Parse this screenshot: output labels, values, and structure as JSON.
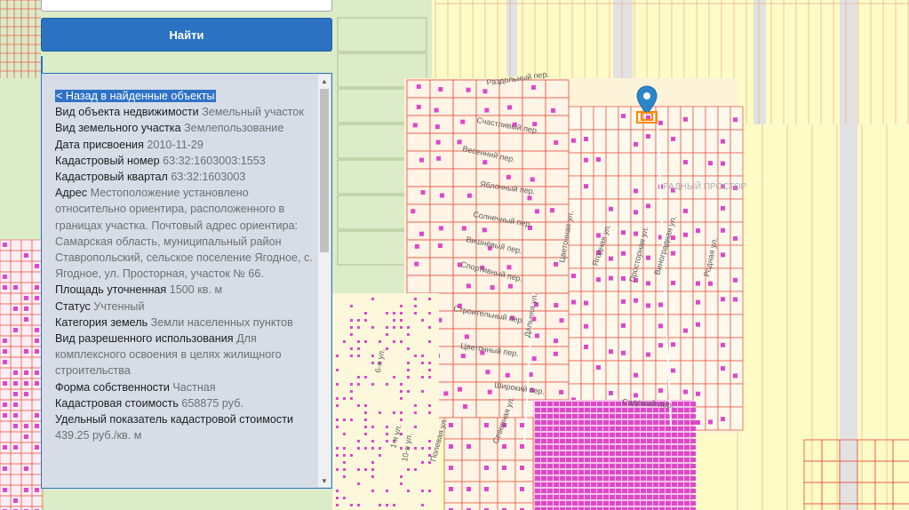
{
  "search": {
    "button_label": "Найти"
  },
  "info": {
    "back_link": "< Назад в найденные объекты",
    "fields": [
      {
        "label": "Вид объекта недвижимости",
        "value": "Земельный участок"
      },
      {
        "label": "Вид земельного участка",
        "value": "Землепользование"
      },
      {
        "label": "Дата присвоения",
        "value": "2010-11-29"
      },
      {
        "label": "Кадастровый номер",
        "value": "63:32:1603003:1553"
      },
      {
        "label": "Кадастровый квартал",
        "value": "63:32:1603003"
      },
      {
        "label": "Адрес",
        "value": "Местоположение установлено относительно ориентира, расположенного в границах участка. Почтовый адрес ориентира: Самарская область, муниципальный район Ставропольский, сельское поселение Ягодное, с. Ягодное, ул. Просторная, участок № 66."
      },
      {
        "label": "Площадь уточненная",
        "value": "1500 кв. м"
      },
      {
        "label": "Статус",
        "value": "Учтенный"
      },
      {
        "label": "Категория земель",
        "value": "Земли населенных пунктов"
      },
      {
        "label": "Вид разрешенного использования",
        "value": "Для комплексного освоения в целях жилищного строительства"
      },
      {
        "label": "Форма собственности",
        "value": "Частная"
      },
      {
        "label": "Кадастровая стоимость",
        "value": "658875 руб."
      },
      {
        "label": "Удельный показатель кадастровой стоимости",
        "value": "439.25 руб./кв. м"
      }
    ]
  },
  "map": {
    "area_label": "РАДНЫЙ ПРОСТОР",
    "street_labels": [
      {
        "text": "Раздольный пер."
      },
      {
        "text": "Счастливый пер."
      },
      {
        "text": "Весенний пер."
      },
      {
        "text": "Яблочный пер."
      },
      {
        "text": "Солнечный пер."
      },
      {
        "text": "Вишнёвый пер."
      },
      {
        "text": "Спортивный пер."
      },
      {
        "text": "Строительный пер."
      },
      {
        "text": "Цветочный пер."
      },
      {
        "text": "Широкий пер."
      },
      {
        "text": "Садовый пер."
      },
      {
        "text": "Просторная ул."
      },
      {
        "text": "Родная ул."
      },
      {
        "text": "Виноградная ул."
      },
      {
        "text": "Ягодная ул."
      },
      {
        "text": "Дальняя ул."
      },
      {
        "text": "Цветочная ул."
      },
      {
        "text": "Северная ул."
      },
      {
        "text": "Полевая ул."
      },
      {
        "text": "1-я ул."
      },
      {
        "text": "6-я ул."
      },
      {
        "text": "10-я ул."
      }
    ],
    "colors": {
      "field": "#fefbc6",
      "green": "#dcebc8",
      "boundary": "#e85c4a",
      "building": "#de48c8",
      "pin": "#2b86c9"
    }
  }
}
